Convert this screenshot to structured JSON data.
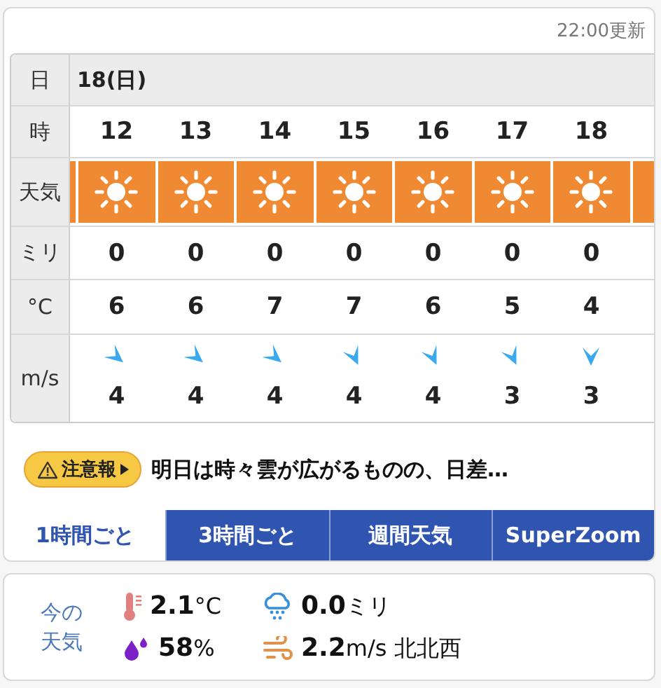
{
  "updated": "22:00更新",
  "forecast": {
    "labels": {
      "date": "日",
      "hour": "時",
      "weather": "天気",
      "rain": "ミリ",
      "temp": "°C",
      "wind": "m/s"
    },
    "date": "18(日)",
    "hours": [
      {
        "kind": "nw",
        "hour": "12",
        "rain": "0",
        "temp": "6",
        "wind": "4"
      },
      {
        "kind": "nw",
        "hour": "13",
        "rain": "0",
        "temp": "6",
        "wind": "4"
      },
      {
        "kind": "nw",
        "hour": "14",
        "rain": "0",
        "temp": "7",
        "wind": "4"
      },
      {
        "kind": "nnw",
        "hour": "15",
        "rain": "0",
        "temp": "7",
        "wind": "4"
      },
      {
        "kind": "nnw",
        "hour": "16",
        "rain": "0",
        "temp": "6",
        "wind": "4"
      },
      {
        "kind": "nnw",
        "hour": "17",
        "rain": "0",
        "temp": "5",
        "wind": "3"
      },
      {
        "kind": "n",
        "hour": "18",
        "rain": "0",
        "temp": "4",
        "wind": "3"
      }
    ]
  },
  "warning": {
    "badge": "注意報",
    "text": "明日は時々雲が広がるものの、日差…"
  },
  "tabs": [
    {
      "label": "1時間ごと",
      "selected": true
    },
    {
      "label": "3時間ごと",
      "selected": false
    },
    {
      "label": "週間天気",
      "selected": false
    },
    {
      "label": "SuperZoom",
      "selected": false
    }
  ],
  "current": {
    "title": "今の天気",
    "items": [
      {
        "kind": "temperature",
        "text": "**2.1**°C"
      },
      {
        "kind": "rain",
        "text": "**0.0**ミリ"
      },
      {
        "kind": "humidity",
        "text": "**58**%"
      },
      {
        "kind": "wind",
        "text": "**2.2**m/s 北北西"
      }
    ]
  }
}
